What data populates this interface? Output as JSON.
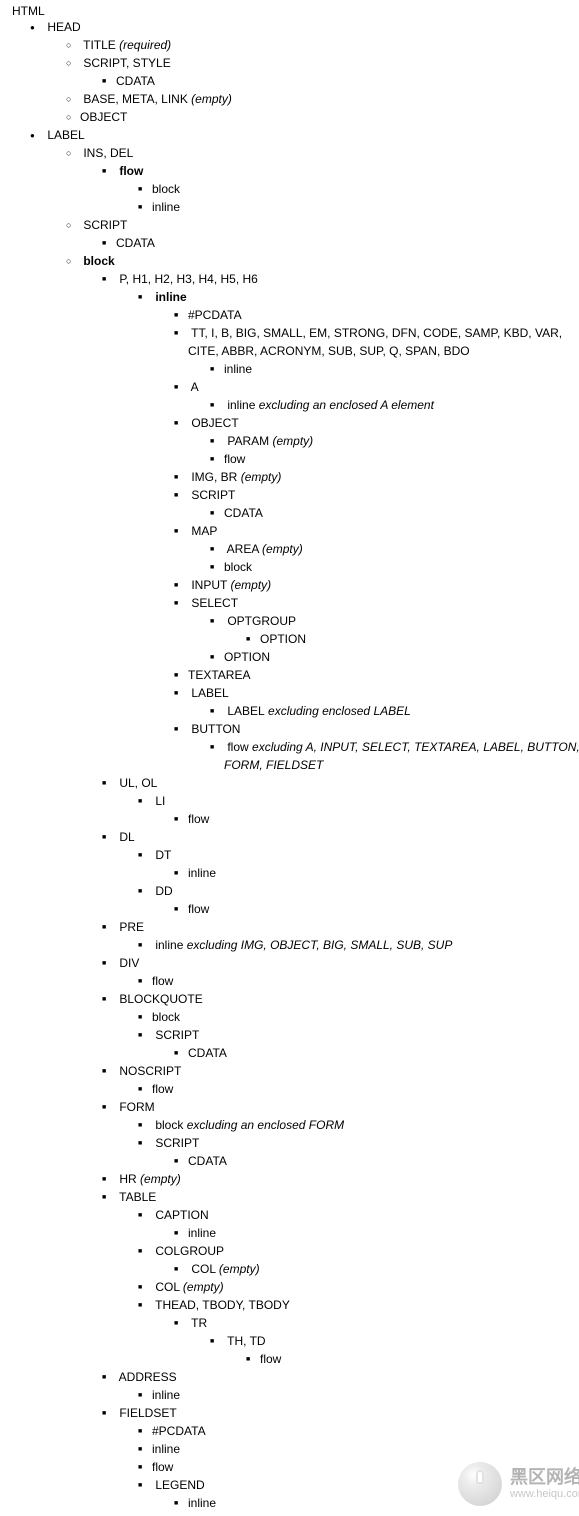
{
  "root": "HTML",
  "head": {
    "label": "HEAD",
    "title": {
      "text": "TITLE",
      "note": "(required)"
    },
    "script_style": "SCRIPT, STYLE",
    "cdata": "CDATA",
    "base_meta_link": {
      "text": "BASE, META, LINK",
      "note": "(empty)"
    },
    "object": "OBJECT"
  },
  "body": {
    "label": "LABEL",
    "ins_del": "INS, DEL",
    "flow": "flow",
    "block": "block",
    "inline": "inline",
    "script": "SCRIPT",
    "cdata": "CDATA",
    "block_label": "block",
    "p_h": "P, H1, H2, H3, H4, H5, H6",
    "inline_label": "inline",
    "pcdata": "#PCDATA",
    "text_elems": "TT, I, B, BIG, SMALL, EM, STRONG, DFN, CODE, SAMP, KBD, VAR, CITE, ABBR, ACRONYM, SUB, SUP, Q, SPAN, BDO",
    "text_inline": "inline",
    "a": "A",
    "a_content": {
      "text": "inline",
      "note": " excluding an enclosed A element"
    },
    "object": "OBJECT",
    "param": {
      "text": "PARAM",
      "note": "(empty)"
    },
    "obj_flow": "flow",
    "img_br": {
      "text": "IMG, BR",
      "note": "(empty)"
    },
    "script_inline": "SCRIPT",
    "script_inline_cdata": "CDATA",
    "map": "MAP",
    "area": {
      "text": "AREA",
      "note": "(empty)"
    },
    "map_block": "block",
    "input": {
      "text": "INPUT",
      "note": "(empty)"
    },
    "select": "SELECT",
    "optgroup": "OPTGROUP",
    "option1": "OPTION",
    "option2": "OPTION",
    "textarea": "TEXTAREA",
    "label_content": {
      "text": "LABEL",
      "note": " excluding enclosed LABEL"
    },
    "button": "BUTTON",
    "button_content": {
      "text": "flow",
      "note": " excluding A, INPUT, SELECT, TEXTAREA, LABEL, BUTTON, FORM, FIELDSET"
    },
    "ul_ol": "UL, OL",
    "li": "LI",
    "li_flow": "flow",
    "dl": "DL",
    "dt": "DT",
    "dt_inline": "inline",
    "dd": "DD",
    "dd_flow": "flow",
    "pre": "PRE",
    "pre_content": {
      "text": "inline",
      "note": " excluding IMG, OBJECT, BIG, SMALL, SUB, SUP"
    },
    "div": "DIV",
    "div_flow": "flow",
    "blockquote": "BLOCKQUOTE",
    "bq_block": "block",
    "bq_script": "SCRIPT",
    "bq_cdata": "CDATA",
    "noscript": "NOSCRIPT",
    "noscript_flow": "flow",
    "form": "FORM",
    "form_block": {
      "text": "block",
      "note": " excluding an enclosed FORM"
    },
    "form_script": "SCRIPT",
    "form_cdata": "CDATA",
    "hr": {
      "text": "HR",
      "note": "(empty)"
    },
    "table": "TABLE",
    "caption": "CAPTION",
    "caption_inline": "inline",
    "colgroup": "COLGROUP",
    "col1": {
      "text": "COL",
      "note": "(empty)"
    },
    "col2": {
      "text": "COL",
      "note": "(empty)"
    },
    "thead": "THEAD, TBODY, TBODY",
    "tr": "TR",
    "th_td": "TH, TD",
    "th_td_flow": "flow",
    "address": "ADDRESS",
    "address_inline": "inline",
    "fieldset": "FIELDSET",
    "fs_pcdata": "#PCDATA",
    "fs_inline": "inline",
    "fs_flow": "flow",
    "legend": "LEGEND",
    "legend_inline": "inline"
  },
  "watermark": {
    "name": "黑区网络",
    "url": "www.heiqu.com"
  }
}
